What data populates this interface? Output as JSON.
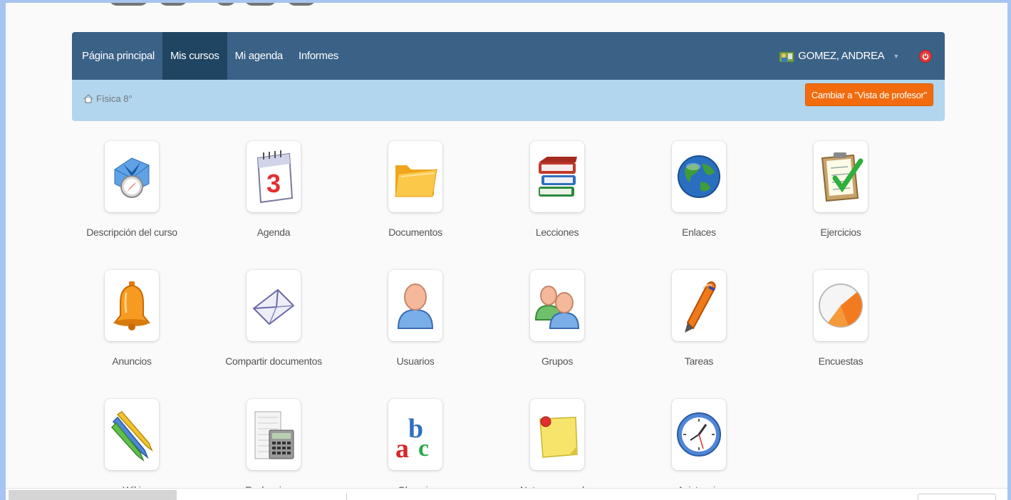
{
  "navbar": {
    "items": [
      {
        "label": "Página principal",
        "active": false
      },
      {
        "label": "Mis cursos",
        "active": true
      },
      {
        "label": "Mi agenda",
        "active": false
      },
      {
        "label": "Informes",
        "active": false
      }
    ],
    "user_name": "GOMEZ, ANDREA",
    "user_icon": "user-avatar-icon",
    "logout_icon": "power-icon"
  },
  "breadcrumb": {
    "icon": "home-icon",
    "course": "Física 8°"
  },
  "switch_view_label": "Cambiar a \"Vista de profesor\"",
  "tools": [
    {
      "label": "Descripción del curso",
      "icon": "course-description-icon"
    },
    {
      "label": "Agenda",
      "icon": "calendar-icon"
    },
    {
      "label": "Documentos",
      "icon": "folder-icon"
    },
    {
      "label": "Lecciones",
      "icon": "books-icon"
    },
    {
      "label": "Enlaces",
      "icon": "globe-icon"
    },
    {
      "label": "Ejercicios",
      "icon": "checklist-icon"
    },
    {
      "label": "Anuncios",
      "icon": "bell-icon"
    },
    {
      "label": "Compartir documentos",
      "icon": "envelope-icon"
    },
    {
      "label": "Usuarios",
      "icon": "user-icon"
    },
    {
      "label": "Grupos",
      "icon": "group-icon"
    },
    {
      "label": "Tareas",
      "icon": "pen-icon"
    },
    {
      "label": "Encuestas",
      "icon": "survey-icon"
    },
    {
      "label": "Wiki",
      "icon": "pencils-icon"
    },
    {
      "label": "Evaluaciones",
      "icon": "calculator-icon"
    },
    {
      "label": "Glosario",
      "icon": "abc-icon"
    },
    {
      "label": "Notas personales",
      "icon": "sticky-note-icon"
    },
    {
      "label": "Asistencia",
      "icon": "clock-icon"
    }
  ],
  "colors": {
    "navbar": "#3a6186",
    "navbar_active": "#1f4563",
    "breadcrumb_bar": "#b1d6ee",
    "switch_button": "#f26c0f"
  }
}
